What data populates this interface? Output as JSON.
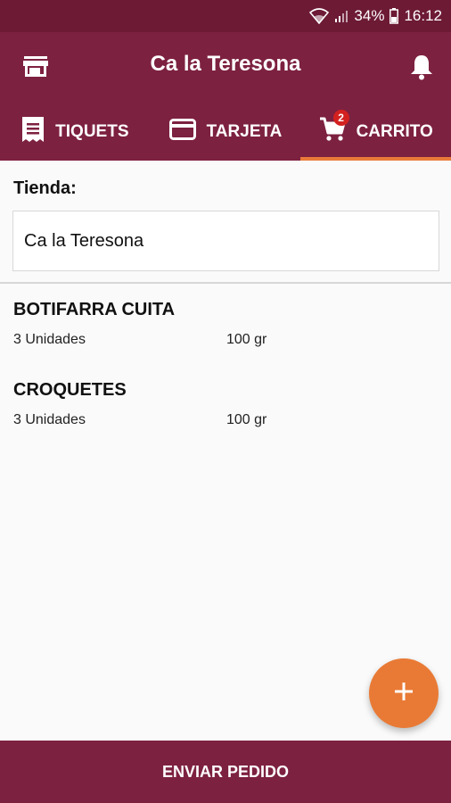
{
  "status_bar": {
    "battery": "34%",
    "time": "16:12"
  },
  "app_bar": {
    "title": "Ca la Teresona"
  },
  "tabs": [
    {
      "label": "TIQUETS",
      "icon": "receipt-icon",
      "active": false
    },
    {
      "label": "TARJETA",
      "icon": "card-icon",
      "active": false
    },
    {
      "label": "CARRITO",
      "icon": "cart-icon",
      "active": true,
      "badge": "2"
    }
  ],
  "store": {
    "label": "Tienda:",
    "value": "Ca la Teresona"
  },
  "items": [
    {
      "name": "BOTIFARRA CUITA",
      "quantity": "3 Unidades",
      "weight": "100 gr"
    },
    {
      "name": "CROQUETES",
      "quantity": "3 Unidades",
      "weight": "100 gr"
    }
  ],
  "bottom_bar": {
    "label": "ENVIAR PEDIDO"
  },
  "colors": {
    "primary": "#7d2140",
    "status_bar": "#6d1a35",
    "accent": "#e97a3a",
    "badge": "#d3211f"
  }
}
